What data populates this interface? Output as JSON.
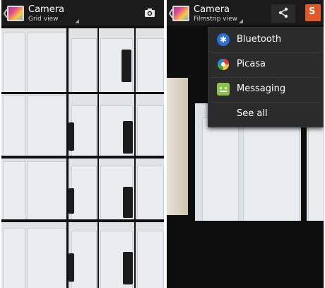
{
  "left_screen": {
    "title": "Camera",
    "subtitle": "Grid view",
    "up_icon": "chevron-left-icon",
    "app_icon": "gallery-icon",
    "action_icon": "camera-icon"
  },
  "right_screen": {
    "title": "Camera",
    "subtitle": "Filmstrip view",
    "up_icon": "chevron-left-icon",
    "app_icon": "gallery-icon",
    "share_icon": "share-icon",
    "share_app_icon": "share-app-icon",
    "share_menu": {
      "items": [
        {
          "label": "Bluetooth",
          "icon": "bluetooth-icon"
        },
        {
          "label": "Picasa",
          "icon": "picasa-icon"
        },
        {
          "label": "Messaging",
          "icon": "messaging-icon"
        },
        {
          "label": "See all",
          "icon": ""
        }
      ]
    }
  },
  "colors": {
    "actionbar_bg": "#1b1b1b",
    "menu_bg": "#2b2b2b",
    "accent_orange": "#e0592a"
  }
}
